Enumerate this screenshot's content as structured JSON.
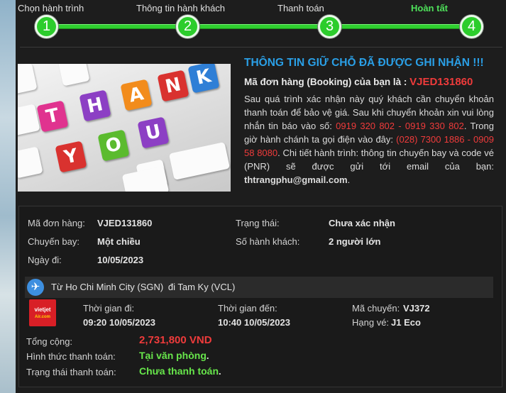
{
  "steps": [
    {
      "label": "Chọn hành trình",
      "number": "1"
    },
    {
      "label": "Thông tin hành khách",
      "number": "2"
    },
    {
      "label": "Thanh toán",
      "number": "3"
    },
    {
      "label": "Hoàn tất",
      "number": "4"
    }
  ],
  "image": {
    "keys": [
      "T",
      "H",
      "A",
      "N",
      "K",
      "Y",
      "O",
      "U"
    ]
  },
  "confirmation": {
    "title": "THÔNG TIN GIỮ CHỖ ĐÃ ĐƯỢC GHI NHẬN !!!",
    "code_label": "Mã đơn hàng (Booking) của bạn là :",
    "code": "VJED131860",
    "body_1": "Sau quá trình xác nhận này quý khách cần chuyển khoản thanh toán để bảo vệ giá. Sau khi chuyển khoản xin vui lòng nhắn tin báo vào số:",
    "sms_numbers": "0919 320 802 - 0919 330 802",
    "body_2": ". Trong giờ hành chánh ta gọi điện vào đây:",
    "phone_numbers": "(028) 7300 1886 - 0909 58 8080",
    "body_3": ". Chi tiết hành trình: thông tin chuyến bay và code vé (PNR) sẽ được gửi tới email của bạn:",
    "email": "thtrangphu@gmail.com",
    "body_end": "."
  },
  "summary": {
    "order_label": "Mã đơn hàng:",
    "order_value": "VJED131860",
    "status_label": "Trạng thái:",
    "status_value": "Chưa xác nhận",
    "flight_label": "Chuyến bay:",
    "flight_value": "Một chiều",
    "pax_label": "Số hành khách:",
    "pax_value": "2 người lớn",
    "date_label": "Ngày đi:",
    "date_value": "10/05/2023",
    "route": {
      "prefix": "Từ",
      "origin": "Ho Chi Minh City (SGN)",
      "connector": "đi",
      "destination": "Tam Ky (VCL)"
    },
    "airline_logo": {
      "line1": "vietjet",
      "line2": "Air.com"
    },
    "depart_label": "Thời gian đi:",
    "depart_value": "09:20 10/05/2023",
    "arrive_label": "Thời gian đến:",
    "arrive_value": "10:40 10/05/2023",
    "flightno_label": "Mã chuyến:",
    "flightno_value": "VJ372",
    "class_label": "Hạng vé:",
    "class_value": "J1 Eco",
    "total_label": "Tổng cộng:",
    "total_value": "2,731,800 VND",
    "method_label": "Hình thức thanh toán:",
    "method_value": "Tại văn phòng",
    "method_end": ".",
    "paystatus_label": "Trạng thái thanh toán:",
    "paystatus_value": "Chưa thanh toán",
    "paystatus_end": "."
  },
  "colors": {
    "accent_blue": "#2a9fe6",
    "alert_red": "#ef3b3b",
    "success_green": "#67e64b",
    "step_green": "#2ccd2c"
  }
}
